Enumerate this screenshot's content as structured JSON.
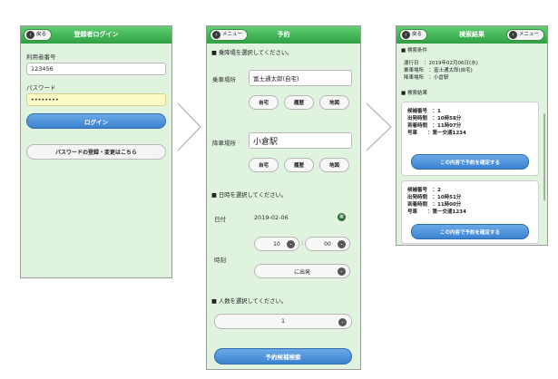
{
  "login": {
    "back_label": "戻る",
    "title": "登録者ログイン",
    "user_label": "利用者番号",
    "user_value": "123456",
    "password_label": "パスワード",
    "password_value": "••••••••",
    "login_button": "ログイン",
    "register_button": "パスワードの登録・変更はこちら"
  },
  "reserve": {
    "menu_label": "メニュー",
    "title": "予約",
    "pickup_section": "■ 乗降場を選択してください。",
    "pickup_label": "乗車場所",
    "pickup_value": "富士通太郎(自宅)",
    "dropoff_label": "降車場所",
    "dropoff_value": "小倉駅",
    "home_button": "自宅",
    "history_button": "履歴",
    "map_button": "地図",
    "datetime_section": "■ 日時を選択してください。",
    "date_label": "日付",
    "date_value": "2019-02-06",
    "time_label": "時刻",
    "hour_value": "10",
    "minute_value": "00",
    "colon": ":",
    "time_mode": "に出発",
    "people_section": "■ 人数を選択してください。",
    "people_value": "1",
    "search_button": "予約候補検索"
  },
  "results": {
    "back_label": "戻る",
    "title": "検索結果",
    "menu_label": "メニュー",
    "conditions_heading": "■ 検索条件",
    "cond_date": "運行日　：2019年02月06日(水)",
    "cond_pickup": "乗車場所　：富士通太郎(自宅)",
    "cond_dropoff": "降車場所　：小倉駅",
    "results_heading": "■ 検索結果",
    "candidates": [
      {
        "line1": "候補番号　：1",
        "line2": "出発時間　：10時58分",
        "line3": "到着時間　：11時07分",
        "line4": "号車　　：第一交通1234",
        "button": "この内容で予約を確定する"
      },
      {
        "line1": "候補番号　：2",
        "line2": "出発時間　：10時51分",
        "line3": "到着時間　：11時00分",
        "line4": "号車　　：第一交通1234",
        "button": "この内容で予約を確定する"
      }
    ]
  },
  "colors": {
    "header_green": "#2f9f44",
    "screen_bg": "#dff3df",
    "button_blue": "#3b82cf",
    "password_highlight": "#fbfbc6"
  }
}
